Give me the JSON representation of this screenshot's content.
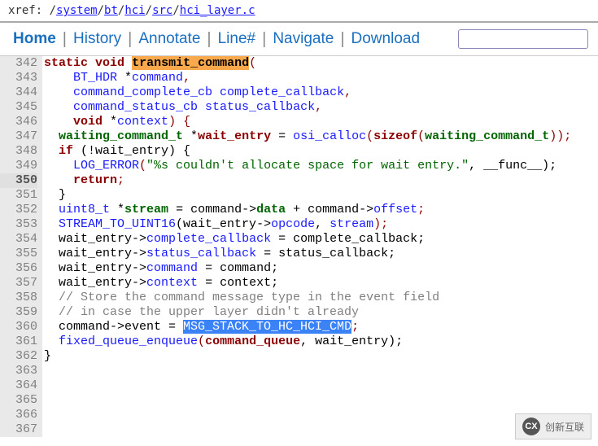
{
  "xref": {
    "label": "xref: ",
    "path_prefix": "/",
    "path_parts": [
      "system",
      "bt",
      "hci",
      "src",
      "hci_layer.c"
    ]
  },
  "nav": {
    "home": "Home",
    "history": "History",
    "annotate": "Annotate",
    "line": "Line#",
    "navigate": "Navigate",
    "download": "Download",
    "sep": "|"
  },
  "lines": {
    "start": 342,
    "end": 367,
    "active": 350
  },
  "code": {
    "l342": "",
    "l343_kw_static": "static",
    "l343_kw_void": "void",
    "l343_fn": "transmit_command",
    "l343_open": "(",
    "l344_type": "BT_HDR",
    "l344_star": " *",
    "l344_ident": "command",
    "l344_comma": ",",
    "l345_type": "command_complete_cb",
    "l345_ident": " complete_callback",
    "l345_comma": ",",
    "l346_type": "command_status_cb",
    "l346_ident": " status_callback",
    "l346_comma": ",",
    "l347_kw": "void",
    "l347_star": " *",
    "l347_ident": "context",
    "l347_close": ") {",
    "l348_type1": "waiting_command_t",
    "l348_star": " *",
    "l348_var": "wait_entry",
    "l348_eq": " = ",
    "l348_fn": "osi_calloc",
    "l348_open": "(",
    "l348_sizeof": "sizeof",
    "l348_open2": "(",
    "l348_type2": "waiting_command_t",
    "l348_close": "));",
    "l349_kw": "if",
    "l349_cond": " (!wait_entry) {",
    "l350_fn": "LOG_ERROR",
    "l350_open": "(",
    "l350_str": "\"%s couldn't allocate space for wait entry.\"",
    "l350_rest": ", __func__);",
    "l351_kw": "return",
    "l351_semi": ";",
    "l352": "  }",
    "l353": "",
    "l354_type": "uint8_t",
    "l354_star": " *",
    "l354_stream": "stream",
    "l354_eq": " = command->",
    "l354_data": "data",
    "l354_plus": " + command->",
    "l354_offset": "offset",
    "l354_semi": ";",
    "l355_fn": "STREAM_TO_UINT16",
    "l355_args": "(wait_entry->",
    "l355_opcode": "opcode",
    "l355_mid": ", ",
    "l355_stream": "stream",
    "l355_close": ");",
    "l356_lhs": "wait_entry->",
    "l356_field": "complete_callback",
    "l356_rhs": " = complete_callback;",
    "l357_lhs": "wait_entry->",
    "l357_field": "status_callback",
    "l357_rhs": " = status_callback;",
    "l358_lhs": "wait_entry->",
    "l358_field": "command",
    "l358_rhs": " = command;",
    "l359_lhs": "wait_entry->",
    "l359_field": "context",
    "l359_rhs": " = context;",
    "l360": "",
    "l361": "  // Store the command message type in the event field",
    "l362": "  // in case the upper layer didn't already",
    "l363_lhs": "  command->event = ",
    "l363_macro": "MSG_STACK_TO_HC_HCI_CMD",
    "l363_semi": ";",
    "l364": "",
    "l365_fn": "fixed_queue_enqueue",
    "l365_open": "(",
    "l365_arg1": "command_queue",
    "l365_rest": ", wait_entry);",
    "l366": "}",
    "l367": ""
  },
  "watermark": {
    "logo": "CX",
    "text": "创新互联"
  }
}
